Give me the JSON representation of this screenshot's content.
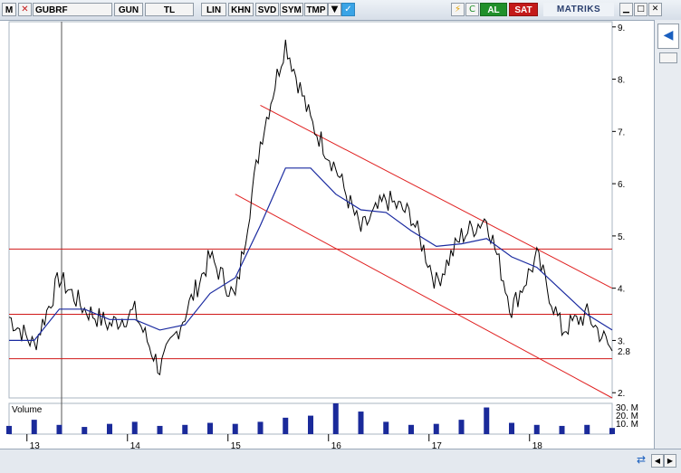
{
  "toolbar": {
    "m_label": "M",
    "symbol": "GUBRF",
    "period": "GUN",
    "currency": "TL",
    "scale": "LIN",
    "khn_label": "KHN",
    "svd_label": "SVD",
    "sym_label": "SYM",
    "tmp_label": "TMP",
    "refresh_label": "C",
    "buy_label": "AL",
    "sell_label": "SAT",
    "brand": "MATRIKS",
    "colors": {
      "buy": "#1f8f2a",
      "sell": "#c41a1a"
    }
  },
  "volume_panel": {
    "label": "Volume",
    "tick_labels": [
      "30. M",
      "20. M",
      "10. M"
    ]
  },
  "colors": {
    "price": "#000000",
    "moving_average": "#1a2aa0",
    "channel": "#e02020",
    "horizontal_level": "#d01818",
    "volume": "#1a2a9a"
  },
  "chart_data": {
    "type": "line",
    "title": "",
    "x": [
      "2012-10",
      "2013-01",
      "2013-04",
      "2013-07",
      "2013-10",
      "2014-01",
      "2014-04",
      "2014-07",
      "2014-10",
      "2015-01",
      "2015-04",
      "2015-07",
      "2015-10",
      "2016-01",
      "2016-04",
      "2016-07",
      "2016-10",
      "2017-01",
      "2017-04",
      "2017-07",
      "2017-10",
      "2018-01",
      "2018-04",
      "2018-07",
      "2018-10"
    ],
    "series": [
      {
        "values": [
          3.45,
          2.9,
          4.2,
          3.6,
          3.3,
          3.55,
          2.45,
          3.5,
          4.6,
          3.8,
          6.8,
          8.7,
          7.2,
          6.3,
          5.1,
          5.7,
          5.4,
          4.1,
          5.0,
          5.35,
          3.6,
          4.6,
          3.2,
          3.5,
          2.8
        ]
      },
      {
        "values": [
          3.0,
          3.0,
          3.6,
          3.6,
          3.4,
          3.4,
          3.2,
          3.3,
          3.9,
          4.2,
          5.2,
          6.3,
          6.3,
          5.8,
          5.5,
          5.45,
          5.1,
          4.8,
          4.85,
          4.95,
          4.6,
          4.4,
          3.95,
          3.5,
          3.2
        ]
      }
    ],
    "y_axis": {
      "ticks": [
        2,
        3,
        4,
        5,
        6,
        7,
        8,
        9
      ],
      "ylim": [
        1.9,
        9.1
      ],
      "last_value_label": "2.8"
    },
    "x_axis": {
      "tick_labels": [
        "13",
        "14",
        "15",
        "16",
        "17",
        "18"
      ]
    },
    "horizontal_levels": [
      4.75,
      3.5,
      2.65
    ],
    "channel_upper": {
      "x": [
        "2015-04",
        "2018-10"
      ],
      "y": [
        7.5,
        4.0
      ]
    },
    "channel_lower": {
      "x": [
        "2015-01",
        "2018-10"
      ],
      "y": [
        5.8,
        1.9
      ]
    },
    "volume": {
      "x": [
        "2012-10",
        "2013-01",
        "2013-04",
        "2013-07",
        "2013-10",
        "2014-01",
        "2014-04",
        "2014-07",
        "2014-10",
        "2015-01",
        "2015-04",
        "2015-07",
        "2015-10",
        "2016-01",
        "2016-04",
        "2016-07",
        "2016-10",
        "2017-01",
        "2017-04",
        "2017-07",
        "2017-10",
        "2018-01",
        "2018-04",
        "2018-07",
        "2018-10"
      ],
      "values": [
        8,
        14,
        9,
        7,
        10,
        12,
        8,
        9,
        11,
        10,
        12,
        16,
        18,
        30,
        22,
        12,
        9,
        10,
        14,
        26,
        11,
        9,
        8,
        9,
        6
      ]
    },
    "grid": false
  }
}
